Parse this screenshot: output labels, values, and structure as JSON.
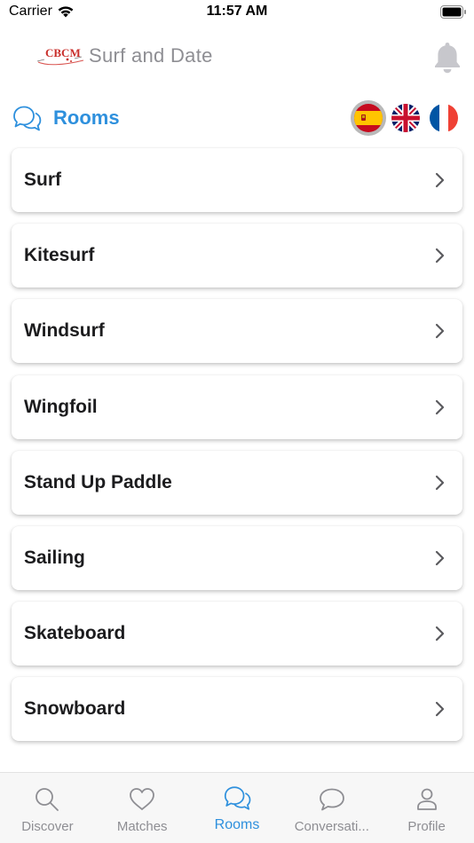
{
  "status_bar": {
    "carrier": "Carrier",
    "time": "11:57 AM"
  },
  "header": {
    "logo_text": "CBCM",
    "title": "Surf and Date",
    "bell_icon": "bell-icon"
  },
  "rooms_section": {
    "title": "Rooms",
    "icon": "chat-bubbles-icon",
    "languages": [
      {
        "name": "spanish-flag-icon",
        "selected": true
      },
      {
        "name": "uk-flag-icon",
        "selected": false
      },
      {
        "name": "french-flag-icon",
        "selected": false
      }
    ]
  },
  "rooms": [
    {
      "label": "Surf"
    },
    {
      "label": "Kitesurf"
    },
    {
      "label": "Windsurf"
    },
    {
      "label": "Wingfoil"
    },
    {
      "label": "Stand Up Paddle"
    },
    {
      "label": "Sailing"
    },
    {
      "label": "Skateboard"
    },
    {
      "label": "Snowboard"
    }
  ],
  "tab_bar": {
    "tabs": [
      {
        "label": "Discover",
        "icon": "search-icon",
        "active": false
      },
      {
        "label": "Matches",
        "icon": "heart-icon",
        "active": false
      },
      {
        "label": "Rooms",
        "icon": "chat-bubbles-icon",
        "active": true
      },
      {
        "label": "Conversati...",
        "icon": "chat-bubble-icon",
        "active": false
      },
      {
        "label": "Profile",
        "icon": "person-icon",
        "active": false
      }
    ]
  },
  "colors": {
    "accent": "#2e90dd",
    "muted": "#8e8e93",
    "bell": "#c7c7cc",
    "tab_bar_bg": "#f7f7f7"
  }
}
